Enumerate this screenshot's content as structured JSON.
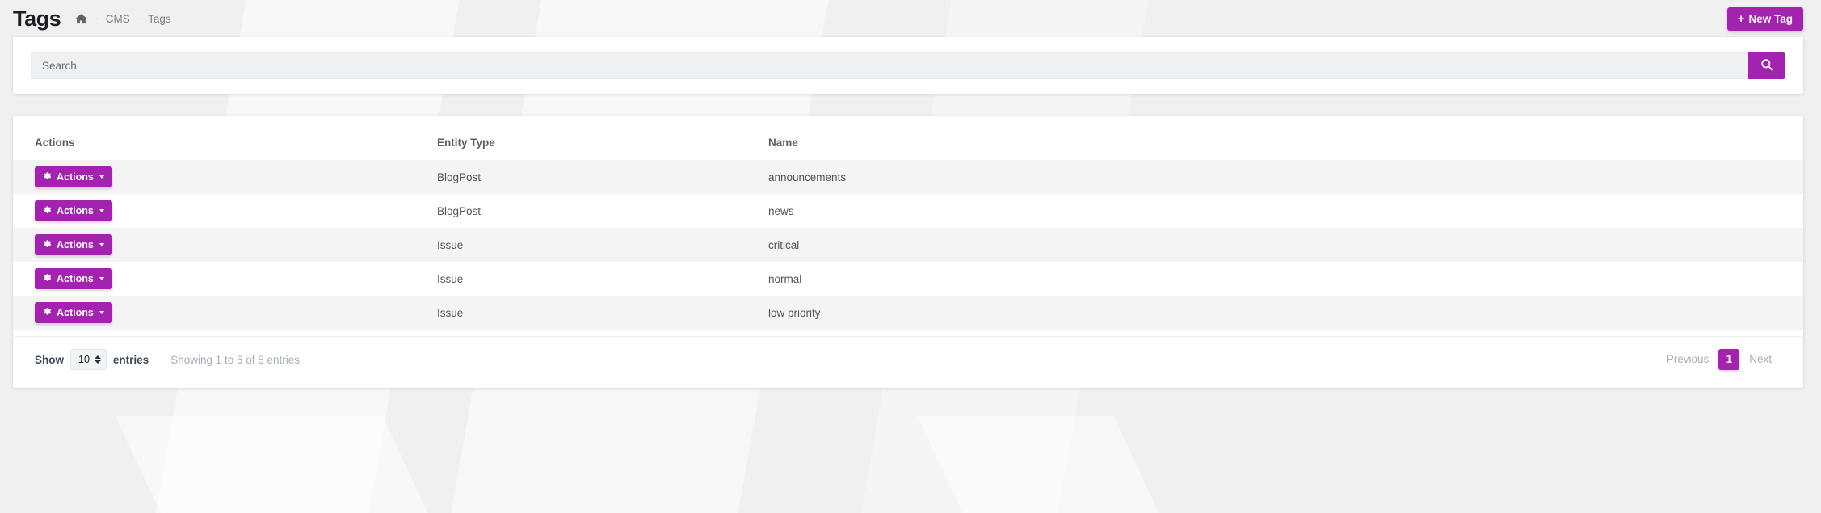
{
  "header": {
    "title": "Tags",
    "breadcrumb": {
      "home_icon": "home-icon",
      "sep": "·",
      "items": [
        {
          "label": "CMS"
        },
        {
          "label": "Tags"
        }
      ]
    },
    "new_button": {
      "plus": "+",
      "label": "New Tag"
    },
    "accent_color": "#a322b0"
  },
  "search": {
    "placeholder": "Search",
    "value": "",
    "button_icon": "search-icon"
  },
  "table": {
    "columns": [
      "Actions",
      "Entity Type",
      "Name"
    ],
    "action_button": {
      "icon": "gear-icon",
      "label": "Actions",
      "caret": "caret-down-icon"
    },
    "rows": [
      {
        "entity_type": "BlogPost",
        "name": "announcements"
      },
      {
        "entity_type": "BlogPost",
        "name": "news"
      },
      {
        "entity_type": "Issue",
        "name": "critical"
      },
      {
        "entity_type": "Issue",
        "name": "normal"
      },
      {
        "entity_type": "Issue",
        "name": "low priority"
      }
    ]
  },
  "footer": {
    "show_label": "Show",
    "entries_label": "entries",
    "page_length": "10",
    "info": "Showing 1 to 5 of 5 entries",
    "pagination": {
      "previous": "Previous",
      "pages": [
        "1"
      ],
      "next": "Next"
    }
  }
}
